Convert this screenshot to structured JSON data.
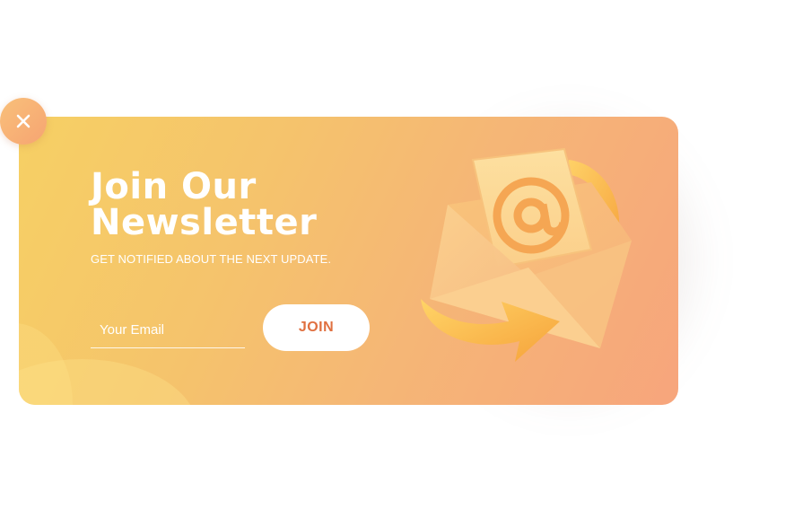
{
  "popup": {
    "title_line1": "Join Our",
    "title_line2": "Newsletter",
    "subtitle": "GET NOTIFIED ABOUT THE NEXT UPDATE.",
    "email_placeholder": "Your Email",
    "email_value": "",
    "join_label": "JOIN",
    "at_symbol": "@"
  },
  "icons": {
    "close": "close-icon",
    "illustration": "envelope-at-icon"
  },
  "colors": {
    "gradient_start": "#f6d064",
    "gradient_end": "#f7a57c",
    "join_text": "#e07040",
    "text": "#ffffff"
  }
}
